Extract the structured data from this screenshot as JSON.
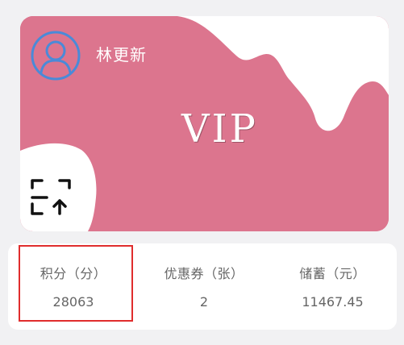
{
  "member_card": {
    "user_name": "林更新",
    "badge": "VIP",
    "colors": {
      "card": "#dc758e",
      "wave": "#ffffff",
      "avatar_stroke": "#4a8ad8"
    },
    "icons": {
      "avatar": "user-avatar-icon",
      "scan": "scan-upload-icon"
    }
  },
  "stats": {
    "points": {
      "label": "积分（分）",
      "value": "28063"
    },
    "coupons": {
      "label": "优惠券（张）",
      "value": "2"
    },
    "savings": {
      "label": "储蓄（元）",
      "value": "11467.45"
    },
    "highlight_color": "#e02d2d"
  }
}
